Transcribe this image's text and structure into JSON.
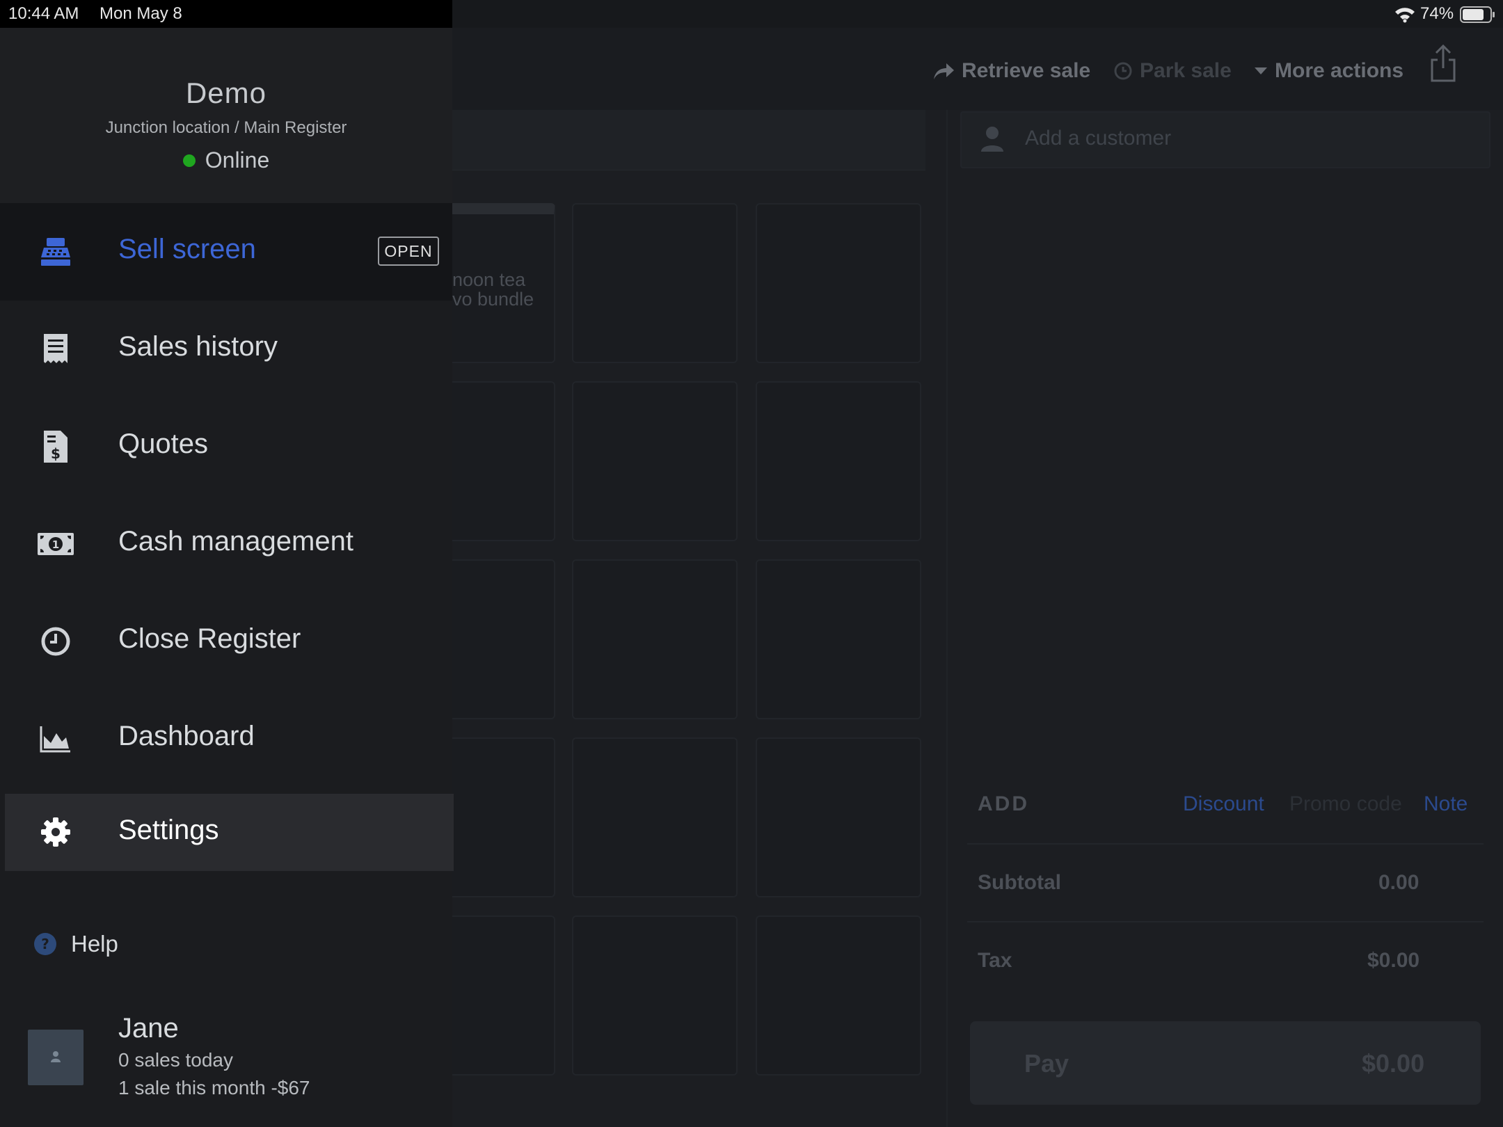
{
  "status_bar": {
    "time": "10:44 AM",
    "date": "Mon May 8",
    "battery": "74%"
  },
  "toolbar": {
    "retrieve_sale": "Retrieve sale",
    "park_sale": "Park sale",
    "more_actions": "More actions"
  },
  "products": {
    "tile_1_line_1": "noon tea",
    "tile_1_line_2": "vo bundle"
  },
  "sale": {
    "customer_placeholder": "Add a customer",
    "add_label": "ADD",
    "discount": "Discount",
    "promo_code": "Promo code",
    "note": "Note",
    "subtotal_label": "Subtotal",
    "subtotal_value": "0.00",
    "tax_label": "Tax",
    "tax_value": "$0.00",
    "pay_label": "Pay",
    "pay_amount": "$0.00"
  },
  "drawer": {
    "store_name": "Demo",
    "location": "Junction location / Main Register",
    "connection_status": "Online",
    "nav": [
      {
        "label": "Sell screen",
        "icon": "register-icon",
        "badge": "OPEN"
      },
      {
        "label": "Sales history",
        "icon": "receipt-icon"
      },
      {
        "label": "Quotes",
        "icon": "quote-document-icon"
      },
      {
        "label": "Cash management",
        "icon": "cash-icon"
      },
      {
        "label": "Close Register",
        "icon": "clock-icon"
      },
      {
        "label": "Dashboard",
        "icon": "area-chart-icon"
      },
      {
        "label": "Settings",
        "icon": "gear-icon"
      }
    ],
    "help_label": "Help",
    "user": {
      "name": "Jane",
      "sales_today": "0 sales today",
      "sales_month": "1 sale this month -$67"
    }
  },
  "colors": {
    "accent_blue": "#3d66d6",
    "online_green": "#1fa61f",
    "drawer_bg": "#1b1c1f"
  }
}
